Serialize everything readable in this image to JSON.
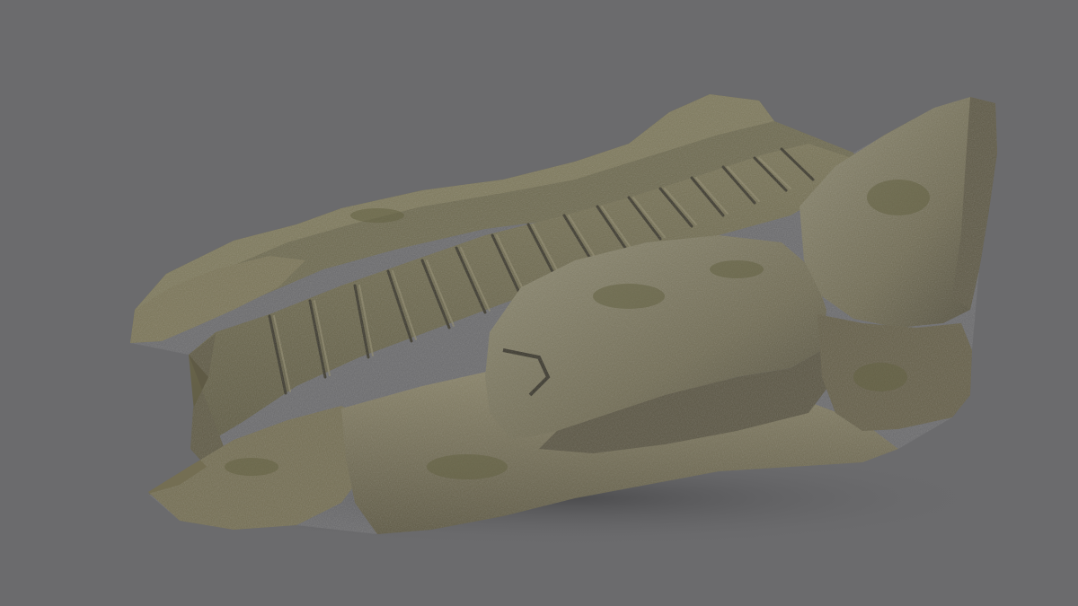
{
  "scene": {
    "background_color": "#6b6b6d",
    "subject": "rock-stairs-model",
    "colors": {
      "rock_light": "#8a8468",
      "rock_mid": "#6f6a52",
      "rock_dark": "#4e4a3a",
      "rock_shadow": "#34322a",
      "moss": "#6d6c48",
      "ground_shadow": "#505052"
    }
  }
}
